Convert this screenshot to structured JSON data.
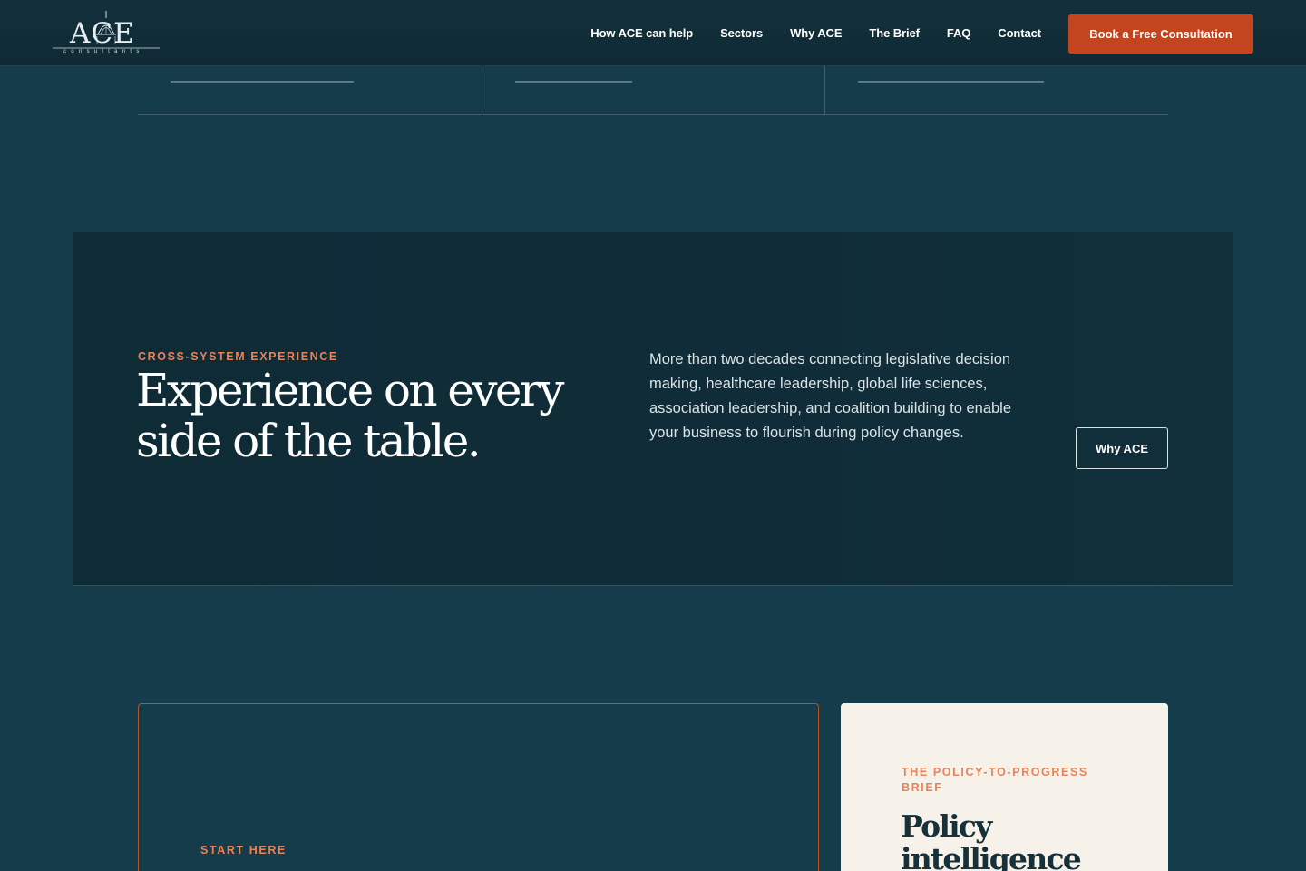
{
  "header": {
    "logo_text": "ACE",
    "logo_subtext": "consultants",
    "nav": [
      {
        "label": "How ACE can help"
      },
      {
        "label": "Sectors"
      },
      {
        "label": "Why ACE"
      },
      {
        "label": "The Brief"
      },
      {
        "label": "FAQ"
      },
      {
        "label": "Contact"
      }
    ],
    "cta_label": "Book a Free Consultation"
  },
  "experience": {
    "eyebrow": "CROSS-SYSTEM EXPERIENCE",
    "title": "Experience on every side of the table.",
    "body": "More than two decades connecting legislative decision making, healthcare leadership, global life sciences, association leadership, and coalition building to enable your business to flourish during policy changes.",
    "button_label": "Why ACE"
  },
  "start": {
    "eyebrow": "START HERE"
  },
  "brief": {
    "eyebrow": "THE POLICY-TO-PROGRESS BRIEF",
    "title": "Policy intelligence for"
  },
  "colors": {
    "background": "#143c4b",
    "panel": "#0f2b36",
    "accent": "#c2451f",
    "eyebrow": "#e8825a",
    "cream": "#f6f2ea"
  }
}
